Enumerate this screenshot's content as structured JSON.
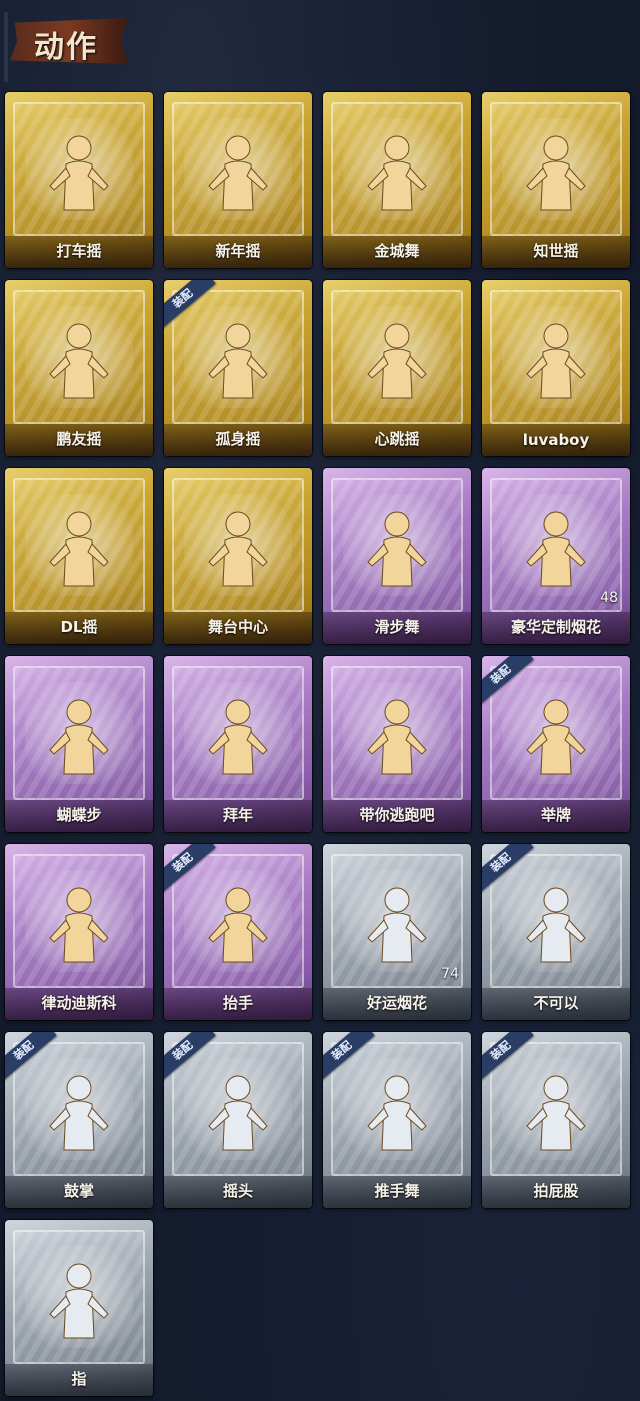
{
  "header": {
    "title": "动作"
  },
  "cards": [
    {
      "label": "打车摇",
      "tier": "gold",
      "equipped": false,
      "count": ""
    },
    {
      "label": "新年摇",
      "tier": "gold",
      "equipped": false,
      "count": ""
    },
    {
      "label": "金城舞",
      "tier": "gold",
      "equipped": false,
      "count": ""
    },
    {
      "label": "知世摇",
      "tier": "gold",
      "equipped": false,
      "count": ""
    },
    {
      "label": "鹏友摇",
      "tier": "gold",
      "equipped": false,
      "count": ""
    },
    {
      "label": "孤身摇",
      "tier": "gold",
      "equipped": true,
      "count": ""
    },
    {
      "label": "心跳摇",
      "tier": "gold",
      "equipped": false,
      "count": ""
    },
    {
      "label": "luvaboy",
      "tier": "gold",
      "equipped": false,
      "count": ""
    },
    {
      "label": "DL摇",
      "tier": "gold",
      "equipped": false,
      "count": ""
    },
    {
      "label": "舞台中心",
      "tier": "gold",
      "equipped": false,
      "count": ""
    },
    {
      "label": "滑步舞",
      "tier": "purple",
      "equipped": false,
      "count": ""
    },
    {
      "label": "豪华定制烟花",
      "tier": "purple",
      "equipped": false,
      "count": "48"
    },
    {
      "label": "蝴蝶步",
      "tier": "purple",
      "equipped": false,
      "count": ""
    },
    {
      "label": "拜年",
      "tier": "purple",
      "equipped": false,
      "count": ""
    },
    {
      "label": "带你逃跑吧",
      "tier": "purple",
      "equipped": false,
      "count": ""
    },
    {
      "label": "举牌",
      "tier": "purple",
      "equipped": true,
      "count": ""
    },
    {
      "label": "律动迪斯科",
      "tier": "purple",
      "equipped": false,
      "count": ""
    },
    {
      "label": "抬手",
      "tier": "purple",
      "equipped": true,
      "count": ""
    },
    {
      "label": "好运烟花",
      "tier": "gray",
      "equipped": false,
      "count": "74"
    },
    {
      "label": "不可以",
      "tier": "gray",
      "equipped": true,
      "count": ""
    },
    {
      "label": "鼓掌",
      "tier": "gray",
      "equipped": true,
      "count": ""
    },
    {
      "label": "摇头",
      "tier": "gray",
      "equipped": true,
      "count": ""
    },
    {
      "label": "推手舞",
      "tier": "gray",
      "equipped": true,
      "count": ""
    },
    {
      "label": "拍屁股",
      "tier": "gray",
      "equipped": true,
      "count": ""
    },
    {
      "label": "指",
      "tier": "gray",
      "equipped": false,
      "count": ""
    }
  ],
  "equip_tag": "装配",
  "colors": {
    "gold": "#c9a532",
    "purple": "#a77cc4",
    "gray": "#9aa3ad",
    "tag": "#2a3d66"
  },
  "icons": {
    "figure": "emote-figure-icon"
  }
}
